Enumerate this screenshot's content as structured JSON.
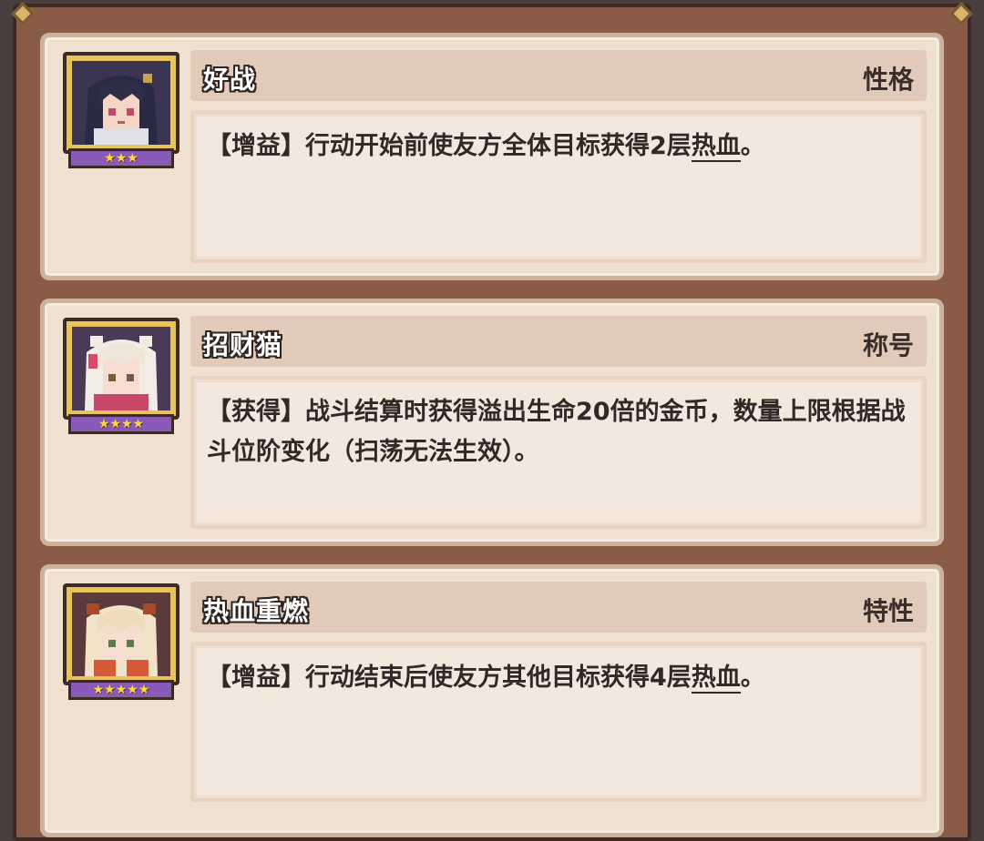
{
  "cards": [
    {
      "name": "好战",
      "category": "性格",
      "stars": 3,
      "star_glyphs": "★★★",
      "desc_prefix": "【增益】行动开始前使友方全体目标获得2层",
      "desc_keyword": "热血",
      "desc_suffix": "。"
    },
    {
      "name": "招财猫",
      "category": "称号",
      "stars": 4,
      "star_glyphs": "★★★★",
      "desc_prefix": "【获得】战斗结算时获得溢出生命20倍的金币，数量上限根据战斗位阶变化（扫荡无法生效）。",
      "desc_keyword": "",
      "desc_suffix": ""
    },
    {
      "name": "热血重燃",
      "category": "特性",
      "stars": 5,
      "star_glyphs": "★★★★★",
      "desc_prefix": "【增益】行动结束后使友方其他目标获得4层",
      "desc_keyword": "热血",
      "desc_suffix": "。"
    }
  ],
  "colors": {
    "frame": "#8a5c48",
    "card_bg": "#efe0d0",
    "star_bar": "#8a5ab8",
    "star": "#ffd84a",
    "portrait_frame": "#e8c25a"
  },
  "icons": [
    "character-portrait",
    "star-icon"
  ]
}
